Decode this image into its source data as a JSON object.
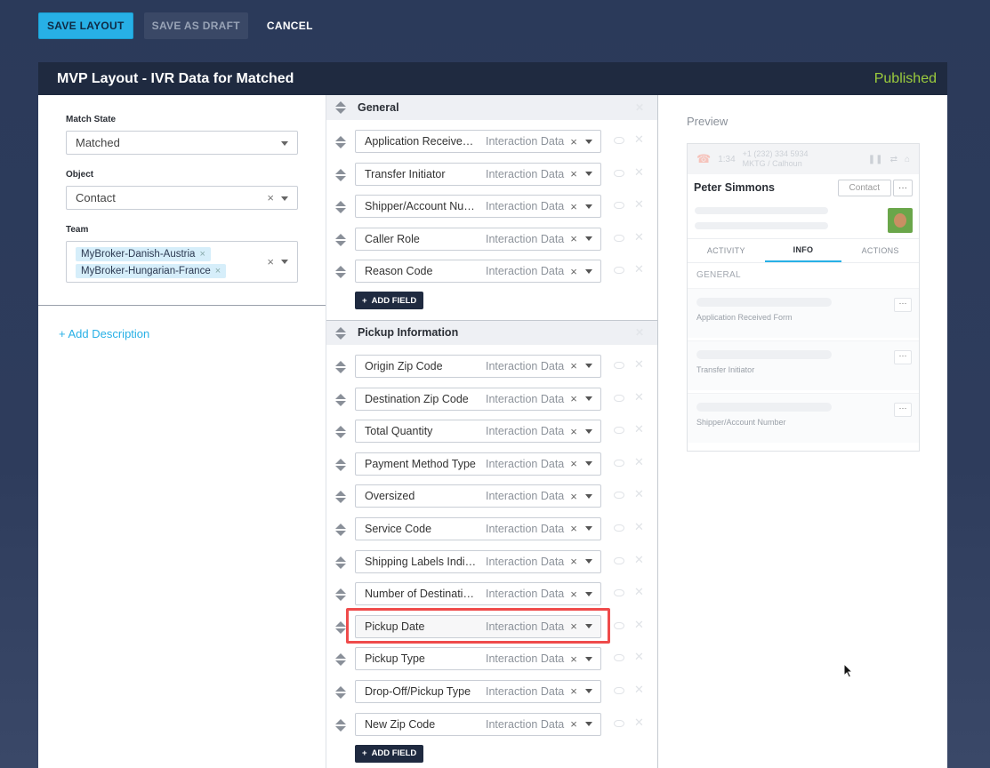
{
  "toolbar": {
    "save_layout": "SAVE LAYOUT",
    "save_as_draft": "SAVE AS DRAFT",
    "cancel": "CANCEL"
  },
  "header": {
    "title": "MVP Layout - IVR Data for Matched",
    "status": "Published",
    "status_color": "#9ccc3d"
  },
  "settings": {
    "match_state_label": "Match State",
    "match_state_value": "Matched",
    "object_label": "Object",
    "object_value": "Contact",
    "team_label": "Team",
    "teams": [
      "MyBroker-Danish-Austria",
      "MyBroker-Hungarian-France"
    ],
    "add_description": "+ Add Description"
  },
  "sections": [
    {
      "title": "General",
      "fields": [
        {
          "name": "Application Received ...",
          "type": "Interaction Data"
        },
        {
          "name": "Transfer Initiator",
          "type": "Interaction Data"
        },
        {
          "name": "Shipper/Account Num...",
          "type": "Interaction Data"
        },
        {
          "name": "Caller Role",
          "type": "Interaction Data"
        },
        {
          "name": "Reason Code",
          "type": "Interaction Data"
        }
      ],
      "add_field": "ADD FIELD"
    },
    {
      "title": "Pickup Information",
      "fields": [
        {
          "name": "Origin Zip Code",
          "type": "Interaction Data"
        },
        {
          "name": "Destination Zip Code",
          "type": "Interaction Data"
        },
        {
          "name": "Total Quantity",
          "type": "Interaction Data"
        },
        {
          "name": "Payment Method Type",
          "type": "Interaction Data"
        },
        {
          "name": "Oversized",
          "type": "Interaction Data"
        },
        {
          "name": "Service Code",
          "type": "Interaction Data"
        },
        {
          "name": "Shipping Labels Indica...",
          "type": "Interaction Data"
        },
        {
          "name": "Number of Destinatio...",
          "type": "Interaction Data"
        },
        {
          "name": "Pickup Date",
          "type": "Interaction Data",
          "highlighted": true
        },
        {
          "name": "Pickup Type",
          "type": "Interaction Data"
        },
        {
          "name": "Drop-Off/Pickup Type",
          "type": "Interaction Data"
        },
        {
          "name": "New Zip Code",
          "type": "Interaction Data"
        }
      ],
      "add_field": "ADD FIELD"
    }
  ],
  "preview": {
    "label": "Preview",
    "call_timer": "1:34",
    "call_number": "+1 (232) 334 5934",
    "call_sub": "MKTG / Calhoun",
    "contact_name": "Peter Simmons",
    "contact_button": "Contact",
    "more_button": "···",
    "tabs": [
      "ACTIVITY",
      "INFO",
      "ACTIONS"
    ],
    "active_tab": "INFO",
    "section_label": "GENERAL",
    "items": [
      "Application Received Form",
      "Transfer Initiator",
      "Shipper/Account Number"
    ]
  }
}
